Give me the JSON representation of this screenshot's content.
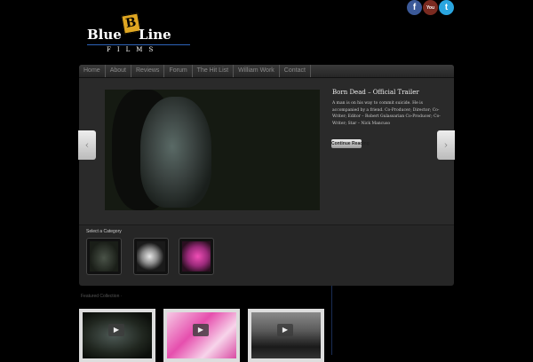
{
  "brand": {
    "word1": "Blue",
    "badge": "B",
    "word2": "Line",
    "sub": "FILMS"
  },
  "social": [
    {
      "icon": "facebook-icon",
      "glyph": "f"
    },
    {
      "icon": "youtube-icon",
      "glyph": "You"
    },
    {
      "icon": "twitter-icon",
      "glyph": "t"
    }
  ],
  "nav": [
    "Home",
    "About",
    "Reviews",
    "Forum",
    "The Hit List",
    "William Work",
    "Contact"
  ],
  "slider": {
    "title": "Born Dead – Official Trailer",
    "description": "A man is on his way to commit suicide. He is accompanied by a friend. Co-Producer; Director; Co-Writer; Editor – Robert Gulassarian Co-Producer; Co-Writer; Star – Nick Mancuso",
    "button": "Continue Reading",
    "prev_glyph": "‹",
    "next_glyph": "›"
  },
  "category": {
    "label": "Select a Category"
  },
  "featured": {
    "label": "Featured Collection ·",
    "play_glyph": "▶"
  },
  "colors": {
    "background": "#000000",
    "panel": "#2a2a2a",
    "accent_blue": "#2d63b8",
    "badge_gold": "#e0a722"
  }
}
